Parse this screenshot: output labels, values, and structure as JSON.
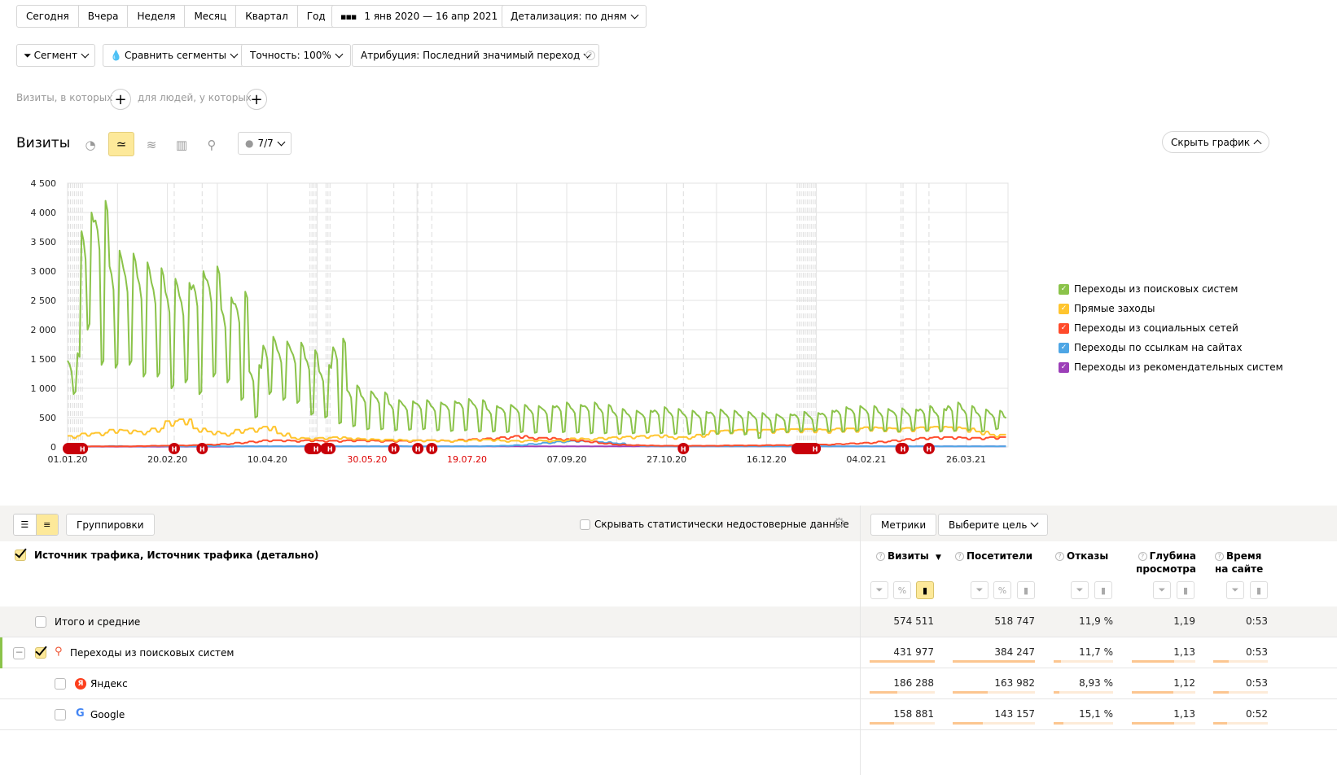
{
  "period_buttons": [
    "Сегодня",
    "Вчера",
    "Неделя",
    "Месяц",
    "Квартал",
    "Год"
  ],
  "date_range": "1 янв 2020 — 16 апр 2021",
  "detail": "Детализация: по дням",
  "segment": "Сегмент",
  "compare": "Сравнить сегменты",
  "accuracy": "Точность: 100%",
  "attribution": "Атрибуция: Последний значимый переход",
  "filter": {
    "visits_label": "Визиты, в которых",
    "people_label": "для людей, у которых"
  },
  "chart_header": {
    "title": "Визиты",
    "annotations": "7/7",
    "hide": "Скрыть график"
  },
  "chart_data": {
    "type": "line",
    "title": "Визиты",
    "xlabel": "",
    "ylabel": "",
    "ylim": [
      0,
      4500
    ],
    "x_range_days": [
      0,
      471
    ],
    "start_date": "01.01.20",
    "y_ticks": [
      "0",
      "500",
      "1 000",
      "1 500",
      "2 000",
      "2 500",
      "3 000",
      "3 500",
      "4 000",
      "4 500"
    ],
    "x_ticks": [
      {
        "day": 0,
        "label": "01.01.20",
        "weekend": false
      },
      {
        "day": 50,
        "label": "20.02.20",
        "weekend": false
      },
      {
        "day": 100,
        "label": "10.04.20",
        "weekend": false
      },
      {
        "day": 150,
        "label": "30.05.20",
        "weekend": true
      },
      {
        "day": 200,
        "label": "19.07.20",
        "weekend": true
      },
      {
        "day": 250,
        "label": "07.09.20",
        "weekend": false
      },
      {
        "day": 300,
        "label": "27.10.20",
        "weekend": false
      },
      {
        "day": 350,
        "label": "16.12.20",
        "weekend": false
      },
      {
        "day": 400,
        "label": "04.02.21",
        "weekend": false
      },
      {
        "day": 450,
        "label": "26.03.21",
        "weekend": false
      }
    ],
    "holiday_marker": "Н",
    "holidays": [
      0,
      1,
      2,
      3,
      4,
      5,
      6,
      7,
      53,
      67,
      121,
      122,
      123,
      124,
      129,
      130,
      131,
      163,
      175,
      182,
      308,
      365,
      366,
      367,
      368,
      369,
      370,
      371,
      372,
      373,
      374,
      417,
      418,
      431
    ],
    "legend_position": "right",
    "series": [
      {
        "name": "Переходы из поисковых систем",
        "color": "#8bc34a",
        "weekly_peak": [
          1600,
          4000,
          4200,
          3350,
          3300,
          3150,
          3050,
          2870,
          2800,
          3000,
          3080,
          2550,
          2650,
          1400,
          1880,
          1800,
          1780,
          1650,
          1400,
          1850,
          1050,
          950,
          930,
          800,
          780,
          800,
          760,
          780,
          820,
          800,
          700,
          720,
          720,
          700,
          700,
          760,
          720,
          760,
          720,
          650,
          620,
          620,
          680,
          650,
          620,
          600,
          640,
          620,
          600,
          580,
          560,
          560,
          600,
          580,
          620,
          680,
          700,
          700,
          650,
          660,
          640,
          700,
          650,
          760,
          700,
          640,
          620,
          560
        ],
        "weekly_low": [
          900,
          2000,
          1400,
          1350,
          1400,
          1200,
          1200,
          1000,
          1100,
          900,
          1200,
          1100,
          800,
          500,
          900,
          800,
          750,
          550,
          500,
          400,
          350,
          300,
          300,
          280,
          290,
          300,
          280,
          270,
          280,
          260,
          260,
          250,
          250,
          240,
          250,
          250,
          240,
          230,
          230,
          220,
          230,
          240,
          230,
          220,
          220,
          210,
          220,
          230,
          210,
          150,
          250,
          250,
          260,
          270,
          260,
          260,
          270,
          280,
          270,
          260,
          280,
          270,
          260,
          270,
          280,
          260,
          300,
          300
        ]
      },
      {
        "name": "Прямые заходы",
        "color": "#ffc52f",
        "weekly": [
          180,
          220,
          230,
          280,
          270,
          250,
          300,
          420,
          450,
          300,
          250,
          220,
          280,
          300,
          330,
          220,
          150,
          140,
          150,
          160,
          140,
          130,
          120,
          120,
          110,
          110,
          110,
          100,
          110,
          120,
          120,
          100,
          100,
          110,
          100,
          110,
          140,
          130,
          150,
          160,
          170,
          180,
          190,
          160,
          160,
          200,
          260,
          270,
          280,
          280,
          280,
          290,
          290,
          290,
          280,
          300,
          300,
          320,
          310,
          300,
          310,
          320,
          330,
          320,
          300,
          250,
          200,
          200
        ]
      },
      {
        "name": "Переходы из социальных сетей",
        "color": "#ff4b2b",
        "weekly": [
          10,
          10,
          10,
          10,
          10,
          15,
          20,
          20,
          25,
          30,
          40,
          50,
          70,
          90,
          110,
          110,
          100,
          110,
          100,
          100,
          110,
          110,
          100,
          100,
          100,
          110,
          110,
          100,
          120,
          130,
          140,
          160,
          180,
          150,
          150,
          130,
          110,
          90,
          60,
          40,
          30,
          25,
          20,
          20,
          20,
          20,
          20,
          25,
          25,
          25,
          30,
          30,
          30,
          40,
          40,
          50,
          60,
          70,
          90,
          110,
          130,
          150,
          160,
          160,
          150,
          150,
          160,
          160
        ]
      },
      {
        "name": "Переходы по ссылкам на сайтах",
        "color": "#4ea6e5",
        "weekly": [
          10,
          10,
          10,
          15,
          10,
          10,
          15,
          10,
          10,
          10,
          15,
          10,
          10,
          10,
          10,
          10,
          10,
          15,
          10,
          10,
          10,
          10,
          10,
          15,
          10,
          10,
          10,
          10,
          10,
          10,
          15,
          20,
          30,
          50,
          70,
          90,
          100,
          90,
          80,
          60,
          30,
          15,
          10,
          10,
          10,
          10,
          10,
          10,
          10,
          10,
          10,
          10,
          10,
          10,
          10,
          10,
          10,
          10,
          10,
          10,
          10,
          10,
          10,
          10,
          10,
          10,
          10,
          10
        ]
      },
      {
        "name": "Переходы из рекомендательных систем",
        "color": "#9c3fb8",
        "weekly": [
          5,
          5,
          5,
          5,
          5,
          5,
          5,
          5,
          5,
          5,
          5,
          5,
          10,
          10,
          10,
          10,
          10,
          10,
          10,
          10,
          10,
          10,
          10,
          10,
          10,
          10,
          10,
          10,
          10,
          10,
          10,
          10,
          10,
          10,
          10,
          10,
          10,
          10,
          10,
          10,
          10,
          10,
          10,
          10,
          10,
          10,
          10,
          10,
          10,
          10,
          10,
          10,
          10,
          10,
          10,
          10,
          10,
          10,
          10,
          10,
          10,
          10,
          10,
          10,
          10,
          10,
          10,
          10
        ]
      }
    ]
  },
  "table": {
    "groupings_btn": "Группировки",
    "hide_unreliable": "Скрывать статистически недостоверные данные",
    "metrics_btn": "Метрики",
    "goal_btn": "Выберите цель",
    "dimension_header": "Источник трафика, Источник трафика (детально)",
    "columns": [
      "Визиты",
      "Посетители",
      "Отказы",
      "Глубина просмотра",
      "Время на сайте"
    ],
    "sort_indicator": "▼",
    "total": {
      "label": "Итого и средние",
      "values": [
        "574 511",
        "518 747",
        "11,9 %",
        "1,19",
        "0:53"
      ]
    },
    "rows": [
      {
        "label": "Переходы из поисковых систем",
        "values": [
          "431 977",
          "384 247",
          "11,7 %",
          "1,13",
          "0:53"
        ],
        "bars": [
          1,
          1,
          0.13,
          0.67,
          0.28
        ],
        "checked": true,
        "expanded": true
      },
      {
        "label": "Яндекс",
        "values": [
          "186 288",
          "163 982",
          "8,93 %",
          "1,12",
          "0:53"
        ],
        "bars": [
          0.43,
          0.43,
          0.1,
          0.66,
          0.28
        ],
        "checked": false
      },
      {
        "label": "Google",
        "values": [
          "158 881",
          "143 157",
          "15,1 %",
          "1,13",
          "0:52"
        ],
        "bars": [
          0.37,
          0.37,
          0.17,
          0.67,
          0.26
        ],
        "checked": false
      }
    ]
  }
}
